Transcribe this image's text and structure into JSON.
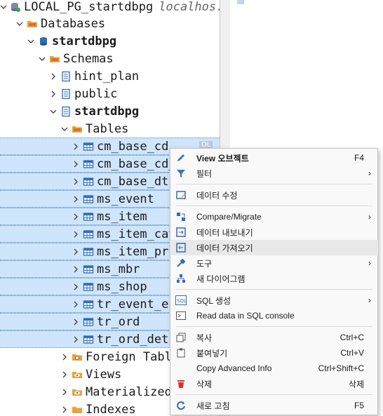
{
  "tree": {
    "connection": {
      "label": "LOCAL_PG_startdbpg",
      "host": "localhos..."
    },
    "databases": "Databases",
    "db_name": "startdbpg",
    "schemas": "Schemas",
    "schema_items": [
      "hint_plan",
      "public",
      "startdbpg"
    ],
    "tables_label": "Tables",
    "tables": [
      "cm_base_cd",
      "cm_base_cd_c",
      "cm_base_dt",
      "ms_event",
      "ms_item",
      "ms_item_cat",
      "ms_item_prc",
      "ms_mbr",
      "ms_shop",
      "tr_event_en",
      "tr_ord",
      "tr_ord_det"
    ],
    "after_tables": [
      "Foreign Table",
      "Views",
      "Materialized",
      "Indexes"
    ],
    "sel_row_badge": "DL"
  },
  "menu": {
    "view_object": {
      "label": "View 오브젝트",
      "key": "F4"
    },
    "filter": {
      "label": "필터"
    },
    "edit_data": {
      "label": "데이터 수정"
    },
    "compare": {
      "label": "Compare/Migrate"
    },
    "export": {
      "label": "데이터 내보내기"
    },
    "import": {
      "label": "데이터 가져오기"
    },
    "tools": {
      "label": "도구"
    },
    "new_diagram": {
      "label": "새 다이어그램"
    },
    "sql_gen": {
      "label": "SQL 생성"
    },
    "read_sql": {
      "label": "Read data in SQL console"
    },
    "copy": {
      "label": "복사",
      "key": "Ctrl+C"
    },
    "paste": {
      "label": "붙여넣기",
      "key": "Ctrl+V"
    },
    "copy_adv": {
      "label": "Copy Advanced Info",
      "key": "Ctrl+Shift+C"
    },
    "delete": {
      "label": "삭제",
      "key": "삭제"
    },
    "refresh": {
      "label": "새로 고침",
      "key": "F5"
    }
  },
  "colors": {
    "selection": "#cfe5fb",
    "delete_icon": "#e0302a",
    "folder": "#e8a33b",
    "table_icon": "#2f6db5"
  }
}
